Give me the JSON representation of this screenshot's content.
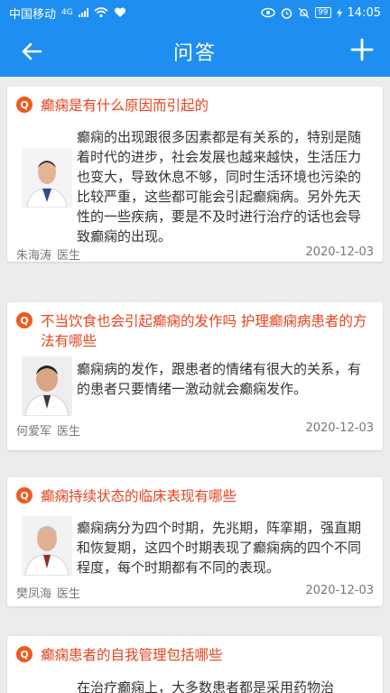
{
  "status_bar": {
    "carrier": "中国移动",
    "network": "4G",
    "battery": "99",
    "time": "14:05"
  },
  "nav": {
    "title": "问答",
    "back_icon": "back-arrow-icon",
    "add_icon": "plus-icon"
  },
  "colors": {
    "primary": "#1e8ff0",
    "question": "#e8431f",
    "q_badge": "#ee5a1e"
  },
  "questions": [
    {
      "badge": "Q",
      "title": "癫痫是有什么原因而引起的",
      "answer": "癫痫的出现跟很多因素都是有关系的，特别是随着时代的进步，社会发展也越来越快，生活压力也变大，导致休息不够，同时生活环境也污染的比较严重，这些都可能会引起癫痫病。另外先天性的一些疾病，要是不及时进行治疗的话也会导致癫痫的出现。",
      "doctor": "朱海涛",
      "role": "医生",
      "date": "2020-12-03"
    },
    {
      "badge": "Q",
      "title": "不当饮食也会引起癫痫的发作吗 护理癫痫病患者的方法有哪些",
      "answer": "癫痫病的发作，跟患者的情绪有很大的关系，有的患者只要情绪一激动就会癫痫发作。",
      "doctor": "何爱军",
      "role": "医生",
      "date": "2020-12-03"
    },
    {
      "badge": "Q",
      "title": "癫痫持续状态的临床表现有哪些",
      "answer": "癫痫病分为四个时期，先兆期，阵挛期，强直期和恢复期，这四个时期表现了癫痫病的四个不同程度，每个时期都有不同的表现。",
      "doctor": "樊凤海",
      "role": "医生",
      "date": "2020-12-03"
    },
    {
      "badge": "Q",
      "title": "癫痫患者的自我管理包括哪些",
      "answer": "在治疗癫痫上，大多数患者都是采用药物治",
      "doctor": "",
      "role": "",
      "date": ""
    }
  ]
}
